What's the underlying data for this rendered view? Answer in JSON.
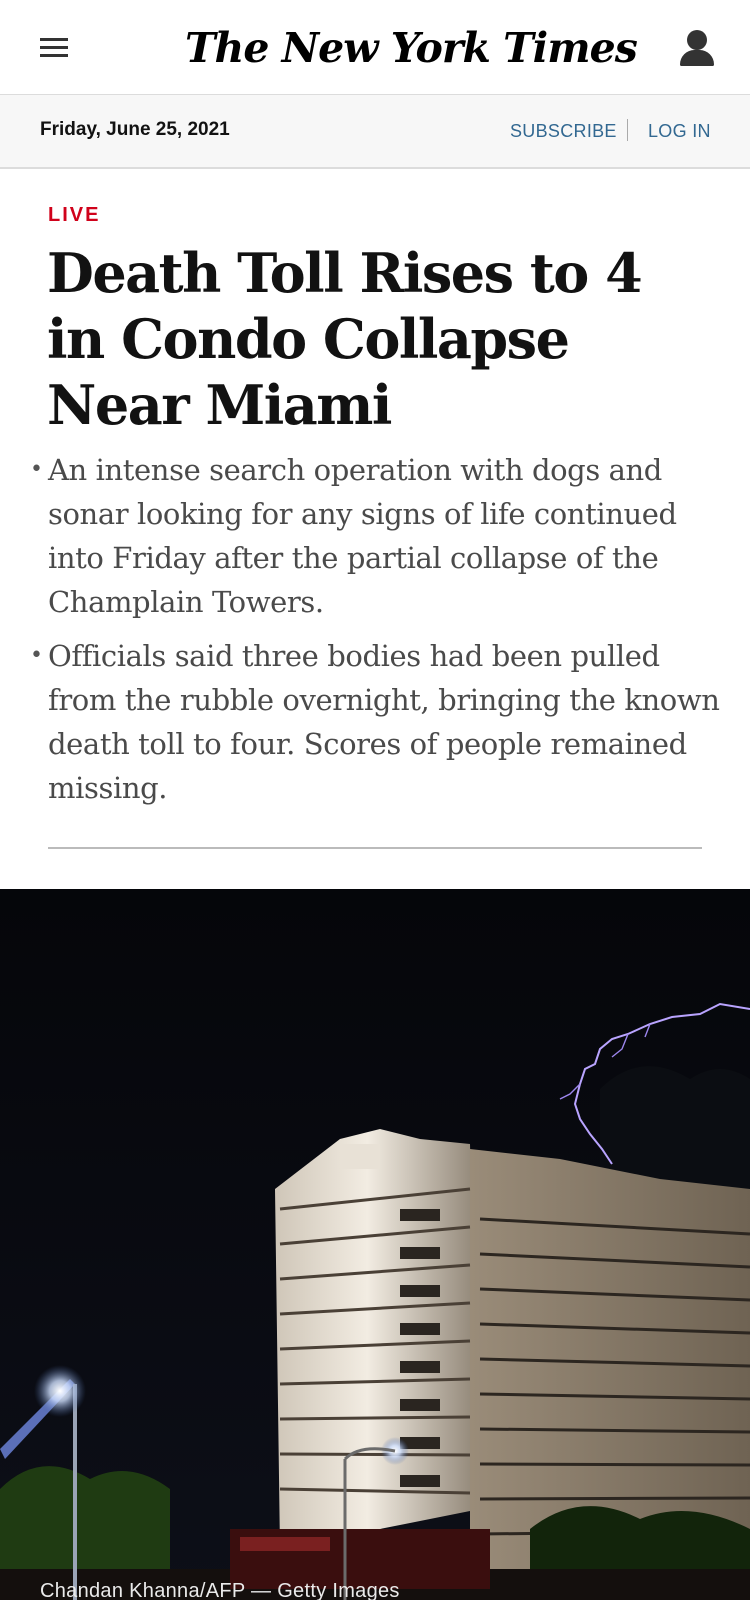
{
  "masthead": {
    "logo": "The New York Times",
    "menu_icon": "hamburger-menu-icon",
    "account_icon": "user-account-icon"
  },
  "datebar": {
    "date": "Friday, June 25, 2021",
    "subscribe": "SUBSCRIBE",
    "login": "LOG IN"
  },
  "article": {
    "live_label": "LIVE",
    "headline": "Death Toll Rises to 4 in Condo Collapse Near Miami",
    "summary": [
      "An intense search operation with dogs and sonar looking for any signs of life continued into Friday after the partial collapse of the Champlain Towers.",
      "Officials said three bodies had been pulled from the rubble overnight, bringing the known death toll to four. Scores of people remained missing."
    ],
    "photo_credit": "Chandan Khanna/AFP — Getty Images"
  },
  "colors": {
    "link": "#326891",
    "live": "#d0021b",
    "headline": "#121212",
    "summary": "#4a4a4a",
    "datebar_bg": "#f7f7f7"
  }
}
